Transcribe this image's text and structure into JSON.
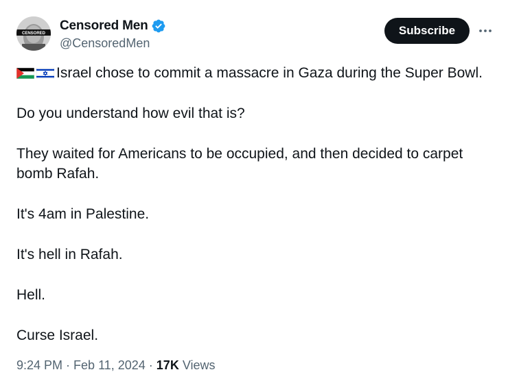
{
  "author": {
    "display_name": "Censored Men",
    "handle": "@CensoredMen",
    "verified": true,
    "avatar_band_text": "CENSORED"
  },
  "actions": {
    "subscribe_label": "Subscribe",
    "more_icon": "more-horizontal-icon"
  },
  "tweet": {
    "flags": [
      "palestine-flag-icon",
      "israel-flag-icon"
    ],
    "paragraphs": [
      "Israel chose to commit a massacre in Gaza during the Super Bowl.",
      "Do you understand how evil that is?",
      "They waited for Americans to be occupied, and then decided to carpet bomb Rafah.",
      "It's 4am in Palestine.",
      "It's hell in Rafah.",
      "Hell.",
      "Curse Israel."
    ]
  },
  "meta": {
    "time": "9:24 PM",
    "date": "Feb 11, 2024",
    "separator": "·",
    "views_count": "17K",
    "views_label": "Views"
  },
  "colors": {
    "text": "#0f1419",
    "muted": "#536471",
    "verified_blue": "#1d9bf0",
    "button_bg": "#0f1419"
  }
}
